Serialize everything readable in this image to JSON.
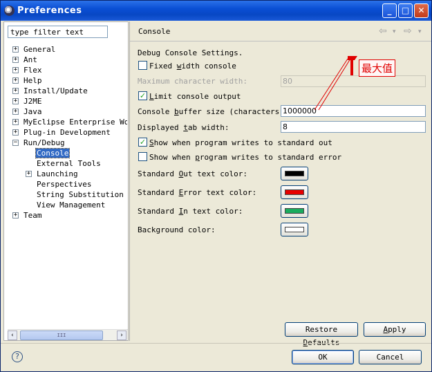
{
  "window": {
    "title": "Preferences",
    "minimize": "_",
    "maximize": "□",
    "close": "✕"
  },
  "left": {
    "filter_value": "type filter text",
    "tree": [
      {
        "label": "General",
        "expander": "+"
      },
      {
        "label": "Ant",
        "expander": "+"
      },
      {
        "label": "Flex",
        "expander": "+"
      },
      {
        "label": "Help",
        "expander": "+"
      },
      {
        "label": "Install/Update",
        "expander": "+"
      },
      {
        "label": "J2ME",
        "expander": "+"
      },
      {
        "label": "Java",
        "expander": "+"
      },
      {
        "label": "MyEclipse Enterprise Work",
        "expander": "+"
      },
      {
        "label": "Plug-in Development",
        "expander": "+"
      },
      {
        "label": "Run/Debug",
        "expander": "−"
      },
      {
        "label": "Console"
      },
      {
        "label": "External Tools"
      },
      {
        "label": "Launching",
        "expander": "+"
      },
      {
        "label": "Perspectives"
      },
      {
        "label": "String Substitution"
      },
      {
        "label": "View Management"
      },
      {
        "label": "Team",
        "expander": "+"
      }
    ],
    "scroll_grip": "III",
    "scroll_left": "‹",
    "scroll_right": "›"
  },
  "right": {
    "page_title": "Console",
    "nav_back": "⇦",
    "nav_fwd": "⇨",
    "nav_drop": "▾",
    "section": "Debug Console Settings.",
    "fixed_width": {
      "pre": "Fixed ",
      "key": "w",
      "post": "idth console",
      "checked": ""
    },
    "max_width": {
      "label": "Maximum character width:",
      "value": "80"
    },
    "limit_output": {
      "pre": "",
      "key": "L",
      "post": "imit console output",
      "checked": "✓"
    },
    "buffer": {
      "pre": "Console ",
      "key": "b",
      "post": "uffer size (characters):",
      "value": "1000000"
    },
    "tab_width": {
      "pre": "Displayed ",
      "key": "t",
      "post": "ab width:",
      "value": "8"
    },
    "show_out": {
      "pre": "",
      "key": "S",
      "post": "how when program writes to standard out",
      "checked": "✓"
    },
    "show_err": {
      "pre": "Show when ",
      "key": "p",
      "post": "rogram writes to standard error",
      "checked": ""
    },
    "colors": {
      "out": {
        "pre": "Standard ",
        "key": "O",
        "post": "ut text color:",
        "swatch": "#000000"
      },
      "err": {
        "pre": "Standard ",
        "key": "E",
        "post": "rror text color:",
        "swatch": "#e60000"
      },
      "in": {
        "pre": "Standard ",
        "key": "I",
        "post": "n text color:",
        "swatch": "#1aac5e"
      },
      "bg": {
        "pre": "Background color:",
        "key": "",
        "post": "",
        "swatch": "#ffffff"
      }
    },
    "restore": {
      "pre": "Restore ",
      "key": "D",
      "post": "efaults"
    },
    "apply": {
      "pre": "",
      "key": "A",
      "post": "pply"
    },
    "annotation": "最大值"
  },
  "footer": {
    "ok": "OK",
    "cancel": "Cancel",
    "help": "?"
  }
}
